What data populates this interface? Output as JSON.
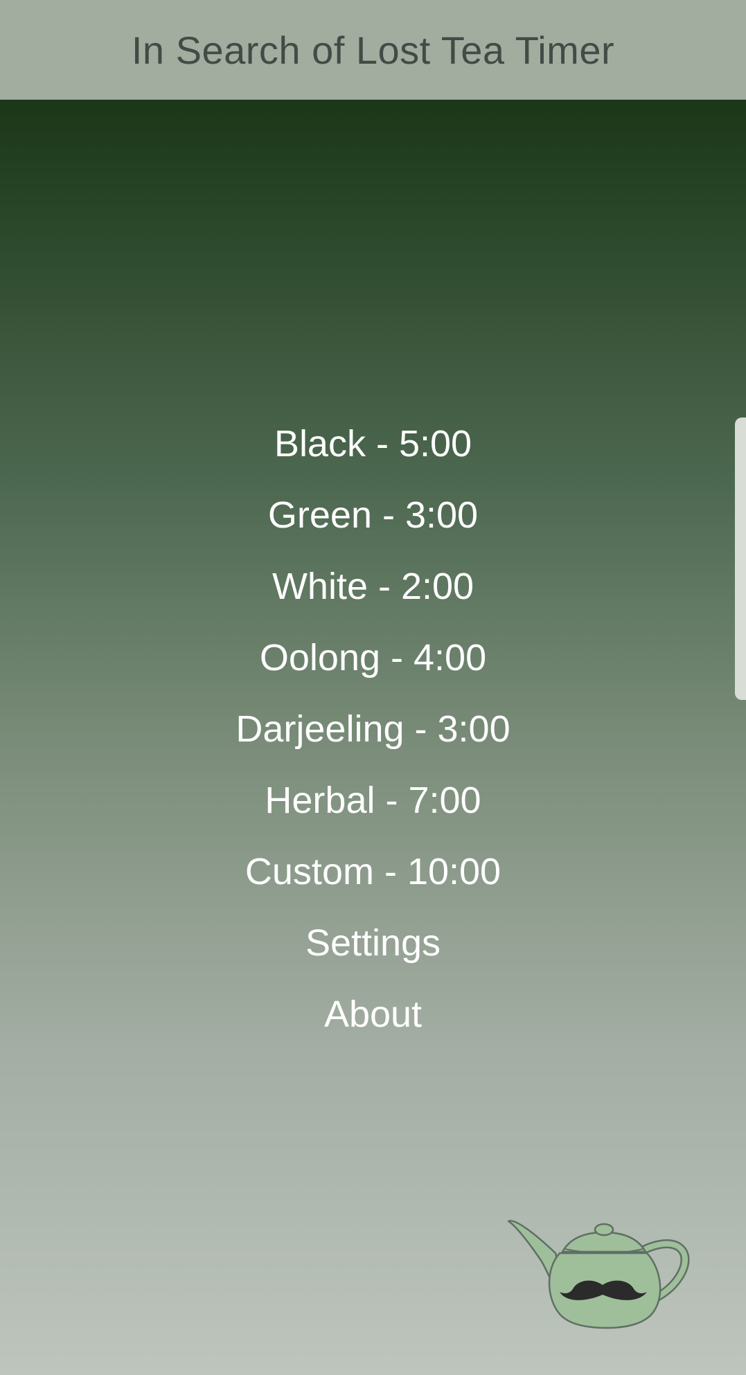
{
  "app": {
    "title": "In Search of Lost Tea Timer"
  },
  "menu": {
    "items": [
      {
        "label": "Black - 5:00"
      },
      {
        "label": "Green - 3:00"
      },
      {
        "label": "White - 2:00"
      },
      {
        "label": "Oolong - 4:00"
      },
      {
        "label": "Darjeeling - 3:00"
      },
      {
        "label": "Herbal - 7:00"
      },
      {
        "label": "Custom - 10:00"
      },
      {
        "label": "Settings"
      },
      {
        "label": "About"
      }
    ]
  },
  "colors": {
    "header_bg": "#a2ada0",
    "title_text": "#444a45",
    "gradient_top": "#1b3718",
    "gradient_bottom": "#bdc5bc",
    "menu_text": "#ffffff",
    "teapot_fill": "#9fbf9a"
  },
  "icons": {
    "mascot": "teapot-with-mustache-icon"
  }
}
